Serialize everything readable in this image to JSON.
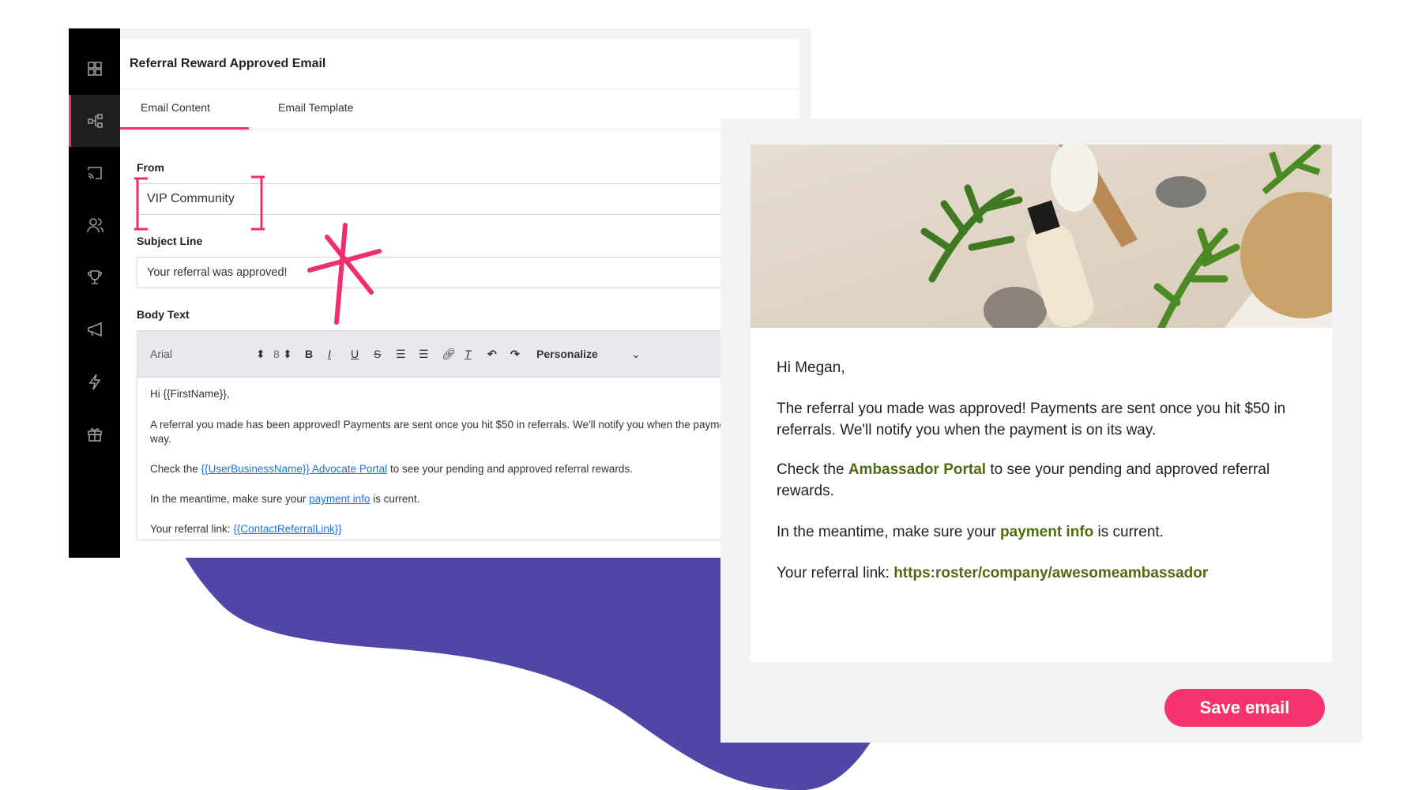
{
  "editor": {
    "title": "Referral Reward Approved Email",
    "tabs": [
      {
        "label": "Email Content",
        "active": true
      },
      {
        "label": "Email Template",
        "active": false
      }
    ],
    "from": {
      "label": "From",
      "value": "VIP Community"
    },
    "subject": {
      "label": "Subject Line",
      "value": "Your referral was approved!"
    },
    "body_label": "Body Text",
    "toolbar": {
      "font": "Arial",
      "size": "8",
      "personalize": "Personalize"
    },
    "body": {
      "greeting": "Hi {{FirstName}},",
      "p1a": "A referral you made has been approved! Payments are sent once you hit $50 in referrals. We'll notify you when the payme",
      "p1b": "way.",
      "p2_pre": "Check the ",
      "p2_link": "{{UserBusinessName}} Advocate Portal",
      "p2_post": " to see your pending and approved referral rewards.",
      "p3_pre": "In the meantime, make sure your ",
      "p3_link": "payment info",
      "p3_post": " is current.",
      "p4_pre": "Your referral link: ",
      "p4_link": "{{ContactReferralLink}}"
    }
  },
  "sidebar": {
    "icons": [
      "grid-icon",
      "flow-icon",
      "cast-icon",
      "users-icon",
      "trophy-icon",
      "megaphone-icon",
      "lightning-icon",
      "gift-icon"
    ],
    "active_index": 1
  },
  "preview": {
    "greeting": "Hi Megan,",
    "p1": "The referral you made was approved! Payments are sent once you hit $50 in referrals. We'll notify you when the payment is on its way.",
    "p2_pre": "Check the ",
    "p2_link": "Ambassador Portal",
    "p2_post": " to see your pending and approved referral rewards.",
    "p3_pre": "In the meantime, make sure your ",
    "p3_link": "payment info",
    "p3_post": " is current.",
    "p4_pre": "Your referral link: ",
    "p4_link": "https:roster/company/awesomeambassador",
    "save_label": "Save email"
  },
  "colors": {
    "accent": "#e8336f",
    "save": "#f5336e",
    "link_preview": "#4f6b10",
    "blob": "#5046a5",
    "link_editor": "#1a73e8"
  }
}
